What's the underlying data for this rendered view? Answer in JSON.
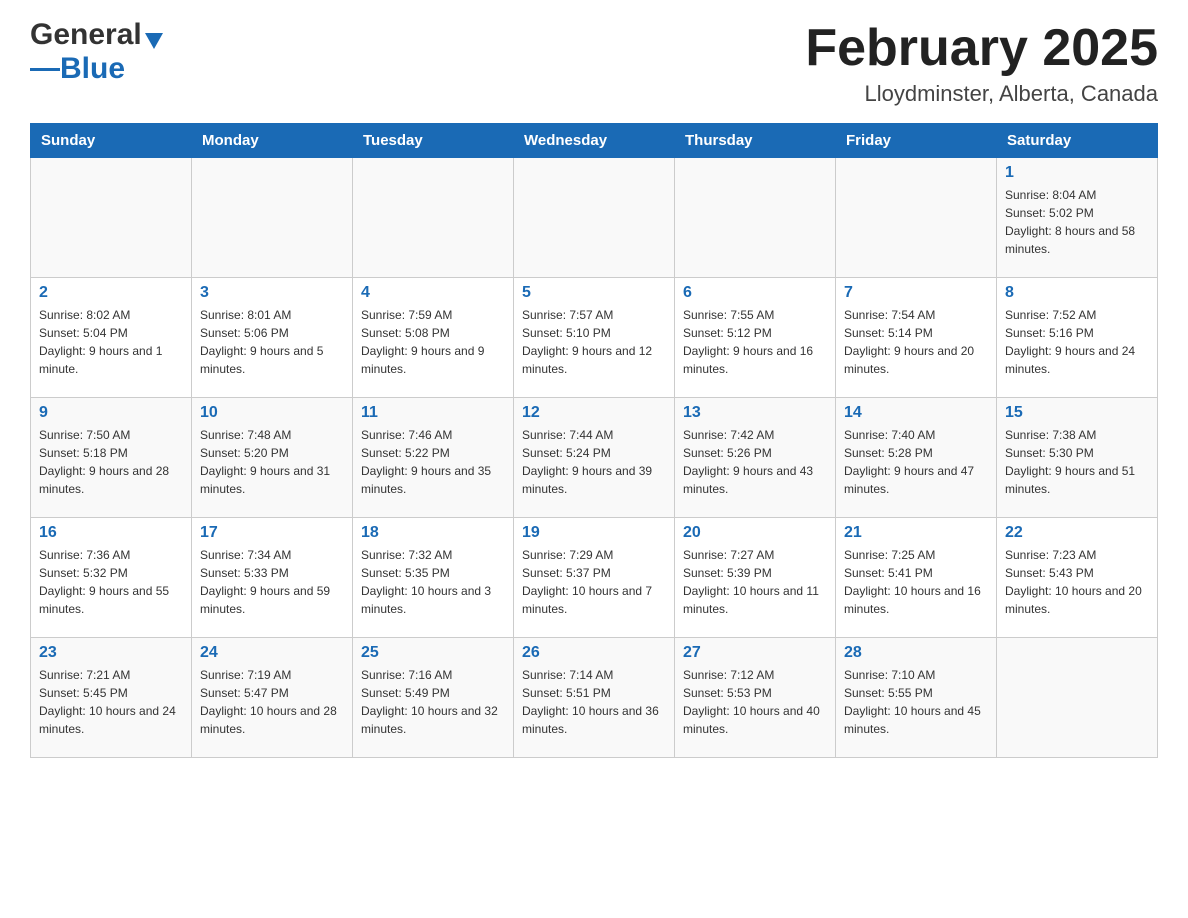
{
  "header": {
    "logo_general": "General",
    "logo_blue": "Blue",
    "month_title": "February 2025",
    "location": "Lloydminster, Alberta, Canada"
  },
  "days_of_week": [
    "Sunday",
    "Monday",
    "Tuesday",
    "Wednesday",
    "Thursday",
    "Friday",
    "Saturday"
  ],
  "weeks": [
    {
      "days": [
        {
          "num": "",
          "info": ""
        },
        {
          "num": "",
          "info": ""
        },
        {
          "num": "",
          "info": ""
        },
        {
          "num": "",
          "info": ""
        },
        {
          "num": "",
          "info": ""
        },
        {
          "num": "",
          "info": ""
        },
        {
          "num": "1",
          "info": "Sunrise: 8:04 AM\nSunset: 5:02 PM\nDaylight: 8 hours and 58 minutes."
        }
      ]
    },
    {
      "days": [
        {
          "num": "2",
          "info": "Sunrise: 8:02 AM\nSunset: 5:04 PM\nDaylight: 9 hours and 1 minute."
        },
        {
          "num": "3",
          "info": "Sunrise: 8:01 AM\nSunset: 5:06 PM\nDaylight: 9 hours and 5 minutes."
        },
        {
          "num": "4",
          "info": "Sunrise: 7:59 AM\nSunset: 5:08 PM\nDaylight: 9 hours and 9 minutes."
        },
        {
          "num": "5",
          "info": "Sunrise: 7:57 AM\nSunset: 5:10 PM\nDaylight: 9 hours and 12 minutes."
        },
        {
          "num": "6",
          "info": "Sunrise: 7:55 AM\nSunset: 5:12 PM\nDaylight: 9 hours and 16 minutes."
        },
        {
          "num": "7",
          "info": "Sunrise: 7:54 AM\nSunset: 5:14 PM\nDaylight: 9 hours and 20 minutes."
        },
        {
          "num": "8",
          "info": "Sunrise: 7:52 AM\nSunset: 5:16 PM\nDaylight: 9 hours and 24 minutes."
        }
      ]
    },
    {
      "days": [
        {
          "num": "9",
          "info": "Sunrise: 7:50 AM\nSunset: 5:18 PM\nDaylight: 9 hours and 28 minutes."
        },
        {
          "num": "10",
          "info": "Sunrise: 7:48 AM\nSunset: 5:20 PM\nDaylight: 9 hours and 31 minutes."
        },
        {
          "num": "11",
          "info": "Sunrise: 7:46 AM\nSunset: 5:22 PM\nDaylight: 9 hours and 35 minutes."
        },
        {
          "num": "12",
          "info": "Sunrise: 7:44 AM\nSunset: 5:24 PM\nDaylight: 9 hours and 39 minutes."
        },
        {
          "num": "13",
          "info": "Sunrise: 7:42 AM\nSunset: 5:26 PM\nDaylight: 9 hours and 43 minutes."
        },
        {
          "num": "14",
          "info": "Sunrise: 7:40 AM\nSunset: 5:28 PM\nDaylight: 9 hours and 47 minutes."
        },
        {
          "num": "15",
          "info": "Sunrise: 7:38 AM\nSunset: 5:30 PM\nDaylight: 9 hours and 51 minutes."
        }
      ]
    },
    {
      "days": [
        {
          "num": "16",
          "info": "Sunrise: 7:36 AM\nSunset: 5:32 PM\nDaylight: 9 hours and 55 minutes."
        },
        {
          "num": "17",
          "info": "Sunrise: 7:34 AM\nSunset: 5:33 PM\nDaylight: 9 hours and 59 minutes."
        },
        {
          "num": "18",
          "info": "Sunrise: 7:32 AM\nSunset: 5:35 PM\nDaylight: 10 hours and 3 minutes."
        },
        {
          "num": "19",
          "info": "Sunrise: 7:29 AM\nSunset: 5:37 PM\nDaylight: 10 hours and 7 minutes."
        },
        {
          "num": "20",
          "info": "Sunrise: 7:27 AM\nSunset: 5:39 PM\nDaylight: 10 hours and 11 minutes."
        },
        {
          "num": "21",
          "info": "Sunrise: 7:25 AM\nSunset: 5:41 PM\nDaylight: 10 hours and 16 minutes."
        },
        {
          "num": "22",
          "info": "Sunrise: 7:23 AM\nSunset: 5:43 PM\nDaylight: 10 hours and 20 minutes."
        }
      ]
    },
    {
      "days": [
        {
          "num": "23",
          "info": "Sunrise: 7:21 AM\nSunset: 5:45 PM\nDaylight: 10 hours and 24 minutes."
        },
        {
          "num": "24",
          "info": "Sunrise: 7:19 AM\nSunset: 5:47 PM\nDaylight: 10 hours and 28 minutes."
        },
        {
          "num": "25",
          "info": "Sunrise: 7:16 AM\nSunset: 5:49 PM\nDaylight: 10 hours and 32 minutes."
        },
        {
          "num": "26",
          "info": "Sunrise: 7:14 AM\nSunset: 5:51 PM\nDaylight: 10 hours and 36 minutes."
        },
        {
          "num": "27",
          "info": "Sunrise: 7:12 AM\nSunset: 5:53 PM\nDaylight: 10 hours and 40 minutes."
        },
        {
          "num": "28",
          "info": "Sunrise: 7:10 AM\nSunset: 5:55 PM\nDaylight: 10 hours and 45 minutes."
        },
        {
          "num": "",
          "info": ""
        }
      ]
    }
  ]
}
